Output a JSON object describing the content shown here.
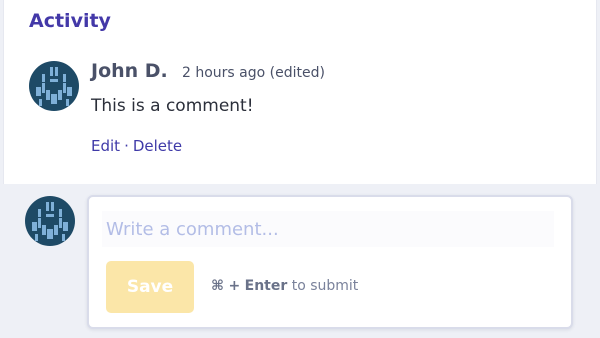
{
  "activity": {
    "title": "Activity"
  },
  "comment": {
    "author": "John D.",
    "time": "2 hours ago",
    "edited_label": "(edited)",
    "body": "This is a comment!",
    "edit_label": "Edit",
    "separator": "·",
    "delete_label": "Delete"
  },
  "composer": {
    "placeholder": "Write a comment...",
    "value": "",
    "save_label": "Save",
    "shortcut_symbol": "⌘",
    "shortcut_plus": "+",
    "shortcut_key": "Enter",
    "shortcut_suffix": "to submit"
  },
  "colors": {
    "accent": "#4338a8",
    "link": "#3f3aa8",
    "save_disabled": "#fbe6a8",
    "avatar_dark": "#1e4a66",
    "avatar_light": "#7fb0d8"
  },
  "icons": {
    "avatar": "identicon-avatar"
  }
}
